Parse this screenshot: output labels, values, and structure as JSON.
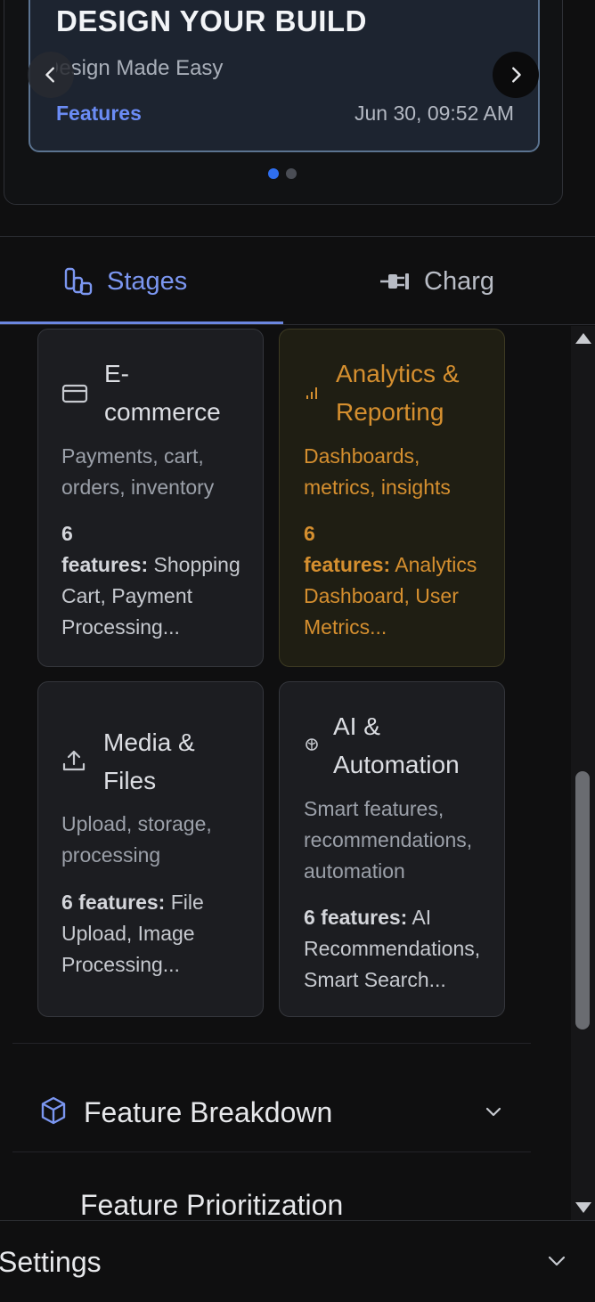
{
  "carousel": {
    "title": "DESIGN YOUR BUILD",
    "subtitle": "Design Made Easy",
    "tag": "Features",
    "date": "Jun 30, 09:52 AM",
    "dots": 2,
    "active_dot": 0
  },
  "tabs": [
    {
      "label": "Stages",
      "icon": "stages-icon",
      "active": true
    },
    {
      "label": "Charg",
      "icon": "plug-icon",
      "active": false
    }
  ],
  "categories": [
    {
      "title_l1": "E-",
      "title_l2": "commerce",
      "icon": "credit-card-icon",
      "desc_l1": "Payments, cart,",
      "desc_l2": "orders, inventory",
      "count_l1": "6",
      "count_l2": "features:",
      "features_l1": "Shopping",
      "features_l2": "Cart, Payment",
      "features_l3": "Processing..."
    },
    {
      "title_l1": "Analytics &",
      "title_l2": "Reporting",
      "icon": "bar-chart-icon",
      "desc_l1": "Dashboards,",
      "desc_l2": "metrics, insights",
      "count_l1": "6",
      "count_l2": "features:",
      "features_l1": "Analytics",
      "features_l2": "Dashboard, User",
      "features_l3": "Metrics..."
    },
    {
      "title_l1": "Media &",
      "title_l2": "Files",
      "icon": "upload-icon",
      "desc_l1": "Upload, storage,",
      "desc_l2": "processing",
      "count": "6 features:",
      "features_l1": "File",
      "features_l2": "Upload, Image",
      "features_l3": "Processing..."
    },
    {
      "title_l1": "AI &",
      "title_l2": "Automation",
      "icon": "brain-icon",
      "desc_l1": "Smart features,",
      "desc_l2": "recommendations,",
      "desc_l3": "automation",
      "count": "6 features:",
      "features_l1": "AI",
      "features_l2": "Recommendations,",
      "features_l3": "Smart Search..."
    }
  ],
  "sections": {
    "feature_breakdown": "Feature Breakdown",
    "feature_prioritization": "Feature Prioritization"
  },
  "settings": {
    "label": "Settings"
  },
  "colors": {
    "accent": "#6b86e0",
    "highlight": "#d58f2f",
    "dot_active": "#2f6ff0"
  }
}
